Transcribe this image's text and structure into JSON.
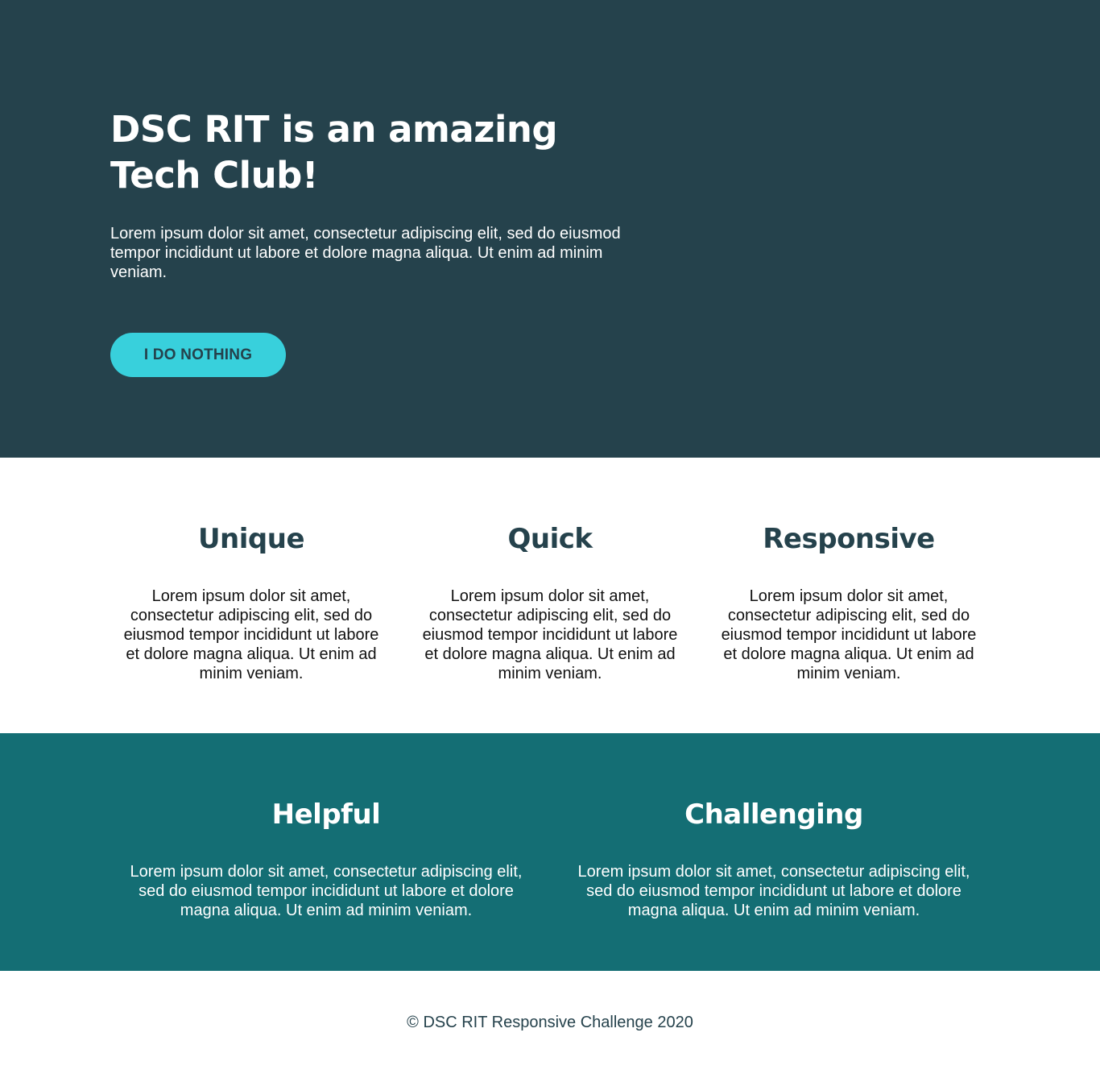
{
  "hero": {
    "title": "DSC RIT is an amazing Tech Club!",
    "text": "Lorem ipsum dolor sit amet, consectetur adipiscing elit, sed do eiusmod tempor incididunt ut labore et dolore magna aliqua. Ut enim ad minim veniam.",
    "button_label": "I DO NOTHING"
  },
  "features": [
    {
      "title": "Unique",
      "text": "Lorem ipsum dolor sit amet, consectetur adipiscing elit, sed do eiusmod tempor incididunt ut labore et dolore magna aliqua. Ut enim ad minim veniam."
    },
    {
      "title": "Quick",
      "text": "Lorem ipsum dolor sit amet, consectetur adipiscing elit, sed do eiusmod tempor incididunt ut labore et dolore magna aliqua. Ut enim ad minim veniam."
    },
    {
      "title": "Responsive",
      "text": "Lorem ipsum dolor sit amet, consectetur adipiscing elit, sed do eiusmod tempor incididunt ut labore et dolore magna aliqua. Ut enim ad minim veniam."
    }
  ],
  "highlights": [
    {
      "title": "Helpful",
      "text": "Lorem ipsum dolor sit amet, consectetur adipiscing elit, sed do eiusmod tempor incididunt ut labore et dolore magna aliqua. Ut enim ad minim veniam."
    },
    {
      "title": "Challenging",
      "text": "Lorem ipsum dolor sit amet, consectetur adipiscing elit, sed do eiusmod tempor incididunt ut labore et dolore magna aliqua. Ut enim ad minim veniam."
    }
  ],
  "footer": {
    "text": "© DSC RIT Responsive Challenge 2020"
  },
  "colors": {
    "hero_bg": "#25424c",
    "accent": "#38d0dc",
    "teal_bg": "#146e74",
    "heading_dark": "#25424c"
  }
}
